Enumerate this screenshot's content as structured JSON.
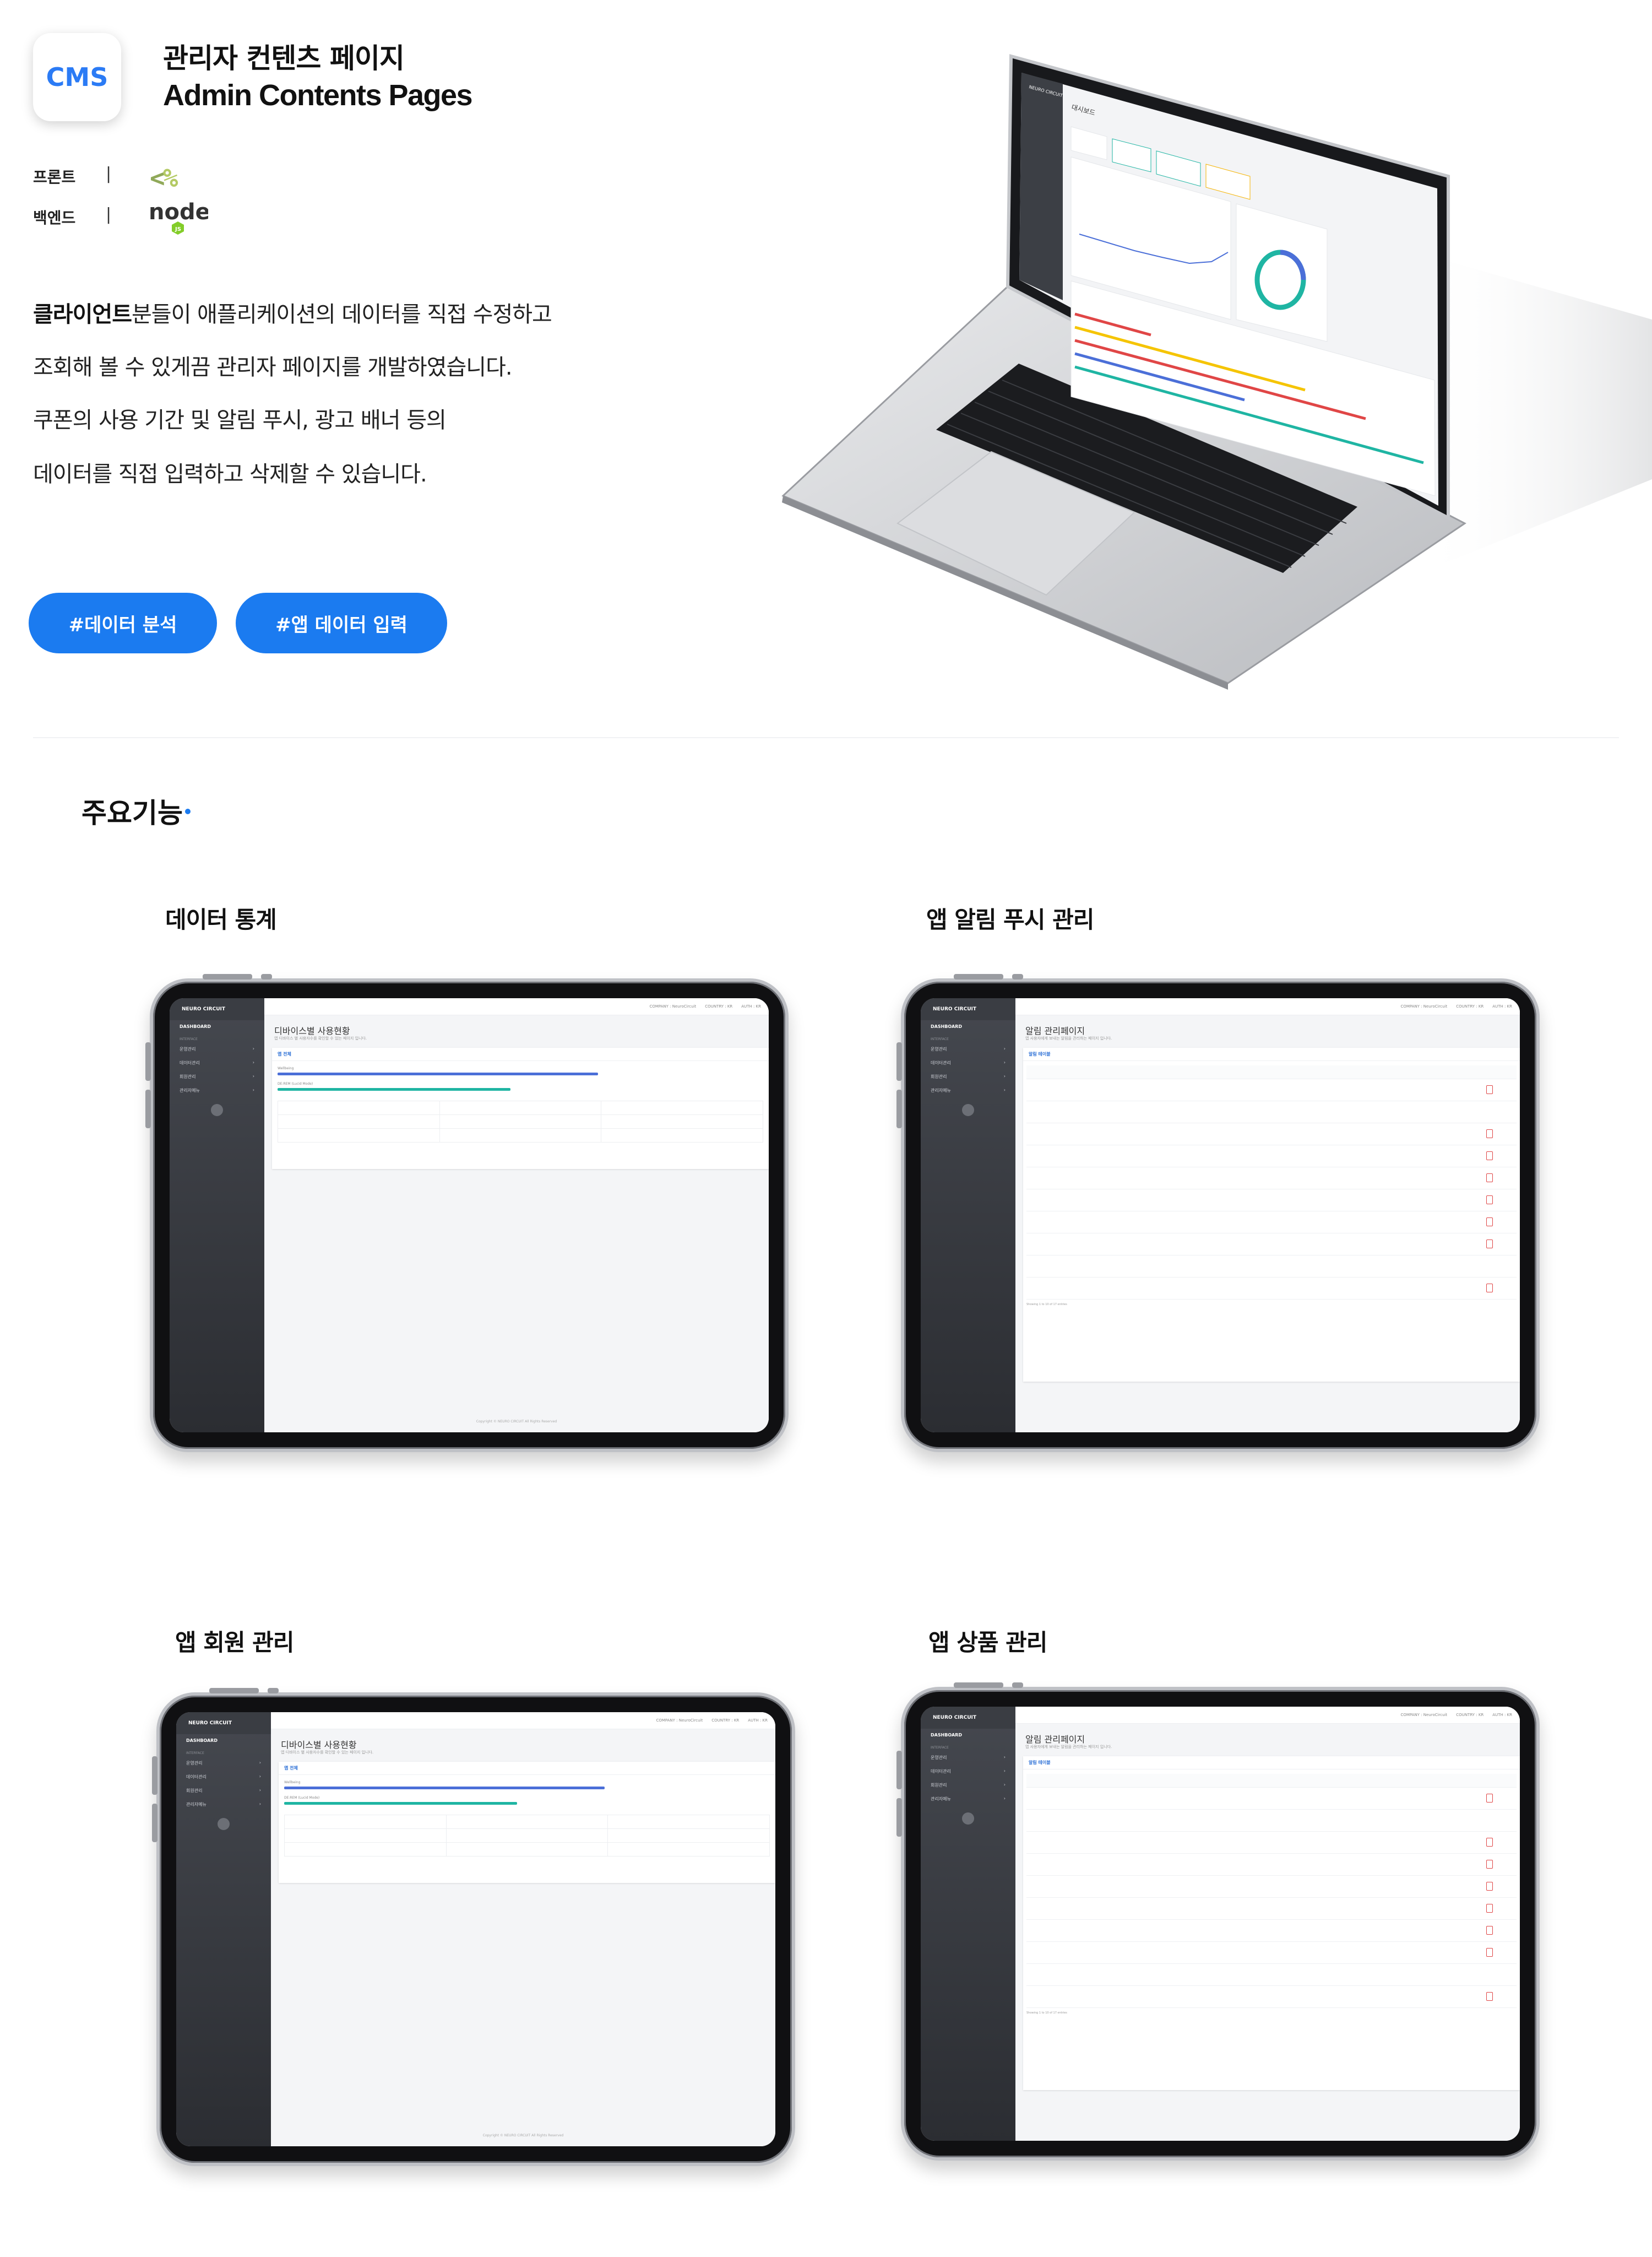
{
  "header": {
    "icon_label": "CMS",
    "title_ko": "관리자 컨텐츠 페이지",
    "title_en": "Admin Contents Pages",
    "stack": [
      {
        "label": "프론트",
        "sep": "|",
        "logo": "ejs-logo",
        "logo_text_a": "<",
        "logo_text_b": "%"
      },
      {
        "label": "백엔드",
        "sep": "|",
        "logo": "nodejs-logo",
        "logo_text": "node"
      }
    ]
  },
  "description": {
    "line1_bold": "클라이언트",
    "line1_rest": "분들이 애플리케이션의 데이터를 직접 수정하고",
    "line2": "조회해 볼 수 있게끔 관리자 페이지를 개발하였습니다.",
    "line3": "쿠폰의 사용 기간 및 알림 푸시, 광고 배너 등의",
    "line4": "데이터를 직접 입력하고 삭제할 수 있습니다."
  },
  "tags": [
    "#데이터 분석",
    "#앱 데이터 입력"
  ],
  "features": {
    "section_title": "주요기능",
    "items": [
      {
        "title": "데이터 통계"
      },
      {
        "title": "앱 알림 푸시 관리"
      },
      {
        "title": "앱 회원 관리"
      },
      {
        "title": "앱 상품 관리"
      }
    ]
  },
  "laptop_screen": {
    "brand": "NEURO CIRCUIT",
    "page_title": "대시보드"
  },
  "mock_ui": {
    "brand": "NEURO CIRCUIT",
    "dashboard": "DASHBOARD",
    "section": "INTERFACE",
    "menu": [
      "운영관리",
      "데이터관리",
      "회원관리",
      "관리자메뉴"
    ],
    "topbar": [
      "COMPANY : NeuroCircuit",
      "COUNTRY : KR",
      "AUTH : KR"
    ],
    "stats_title": "디바이스별 사용현황",
    "stats_sub": "앱 디바이스 별 사용자수를 확인할 수 있는 페이지 입니다.",
    "stats_card": "앱 전체",
    "stats_bar1": "Wellbeing",
    "stats_bar2": "DE:REM (Lucid Mode)",
    "noti_title": "알림 관리페이지",
    "noti_sub": "앱 사용자에게 보내는 알림을 관리하는 페이지 입니다.",
    "noti_card": "알림 테이블",
    "copyright": "Copyright © NEURO CIRCUIT All Rights Reserved",
    "showing": "Showing 1 to 10 of 17 entries"
  },
  "colors": {
    "accent": "#1b7bf0",
    "bar_blue": "#4b6fd8",
    "bar_teal": "#1fb5a3"
  }
}
